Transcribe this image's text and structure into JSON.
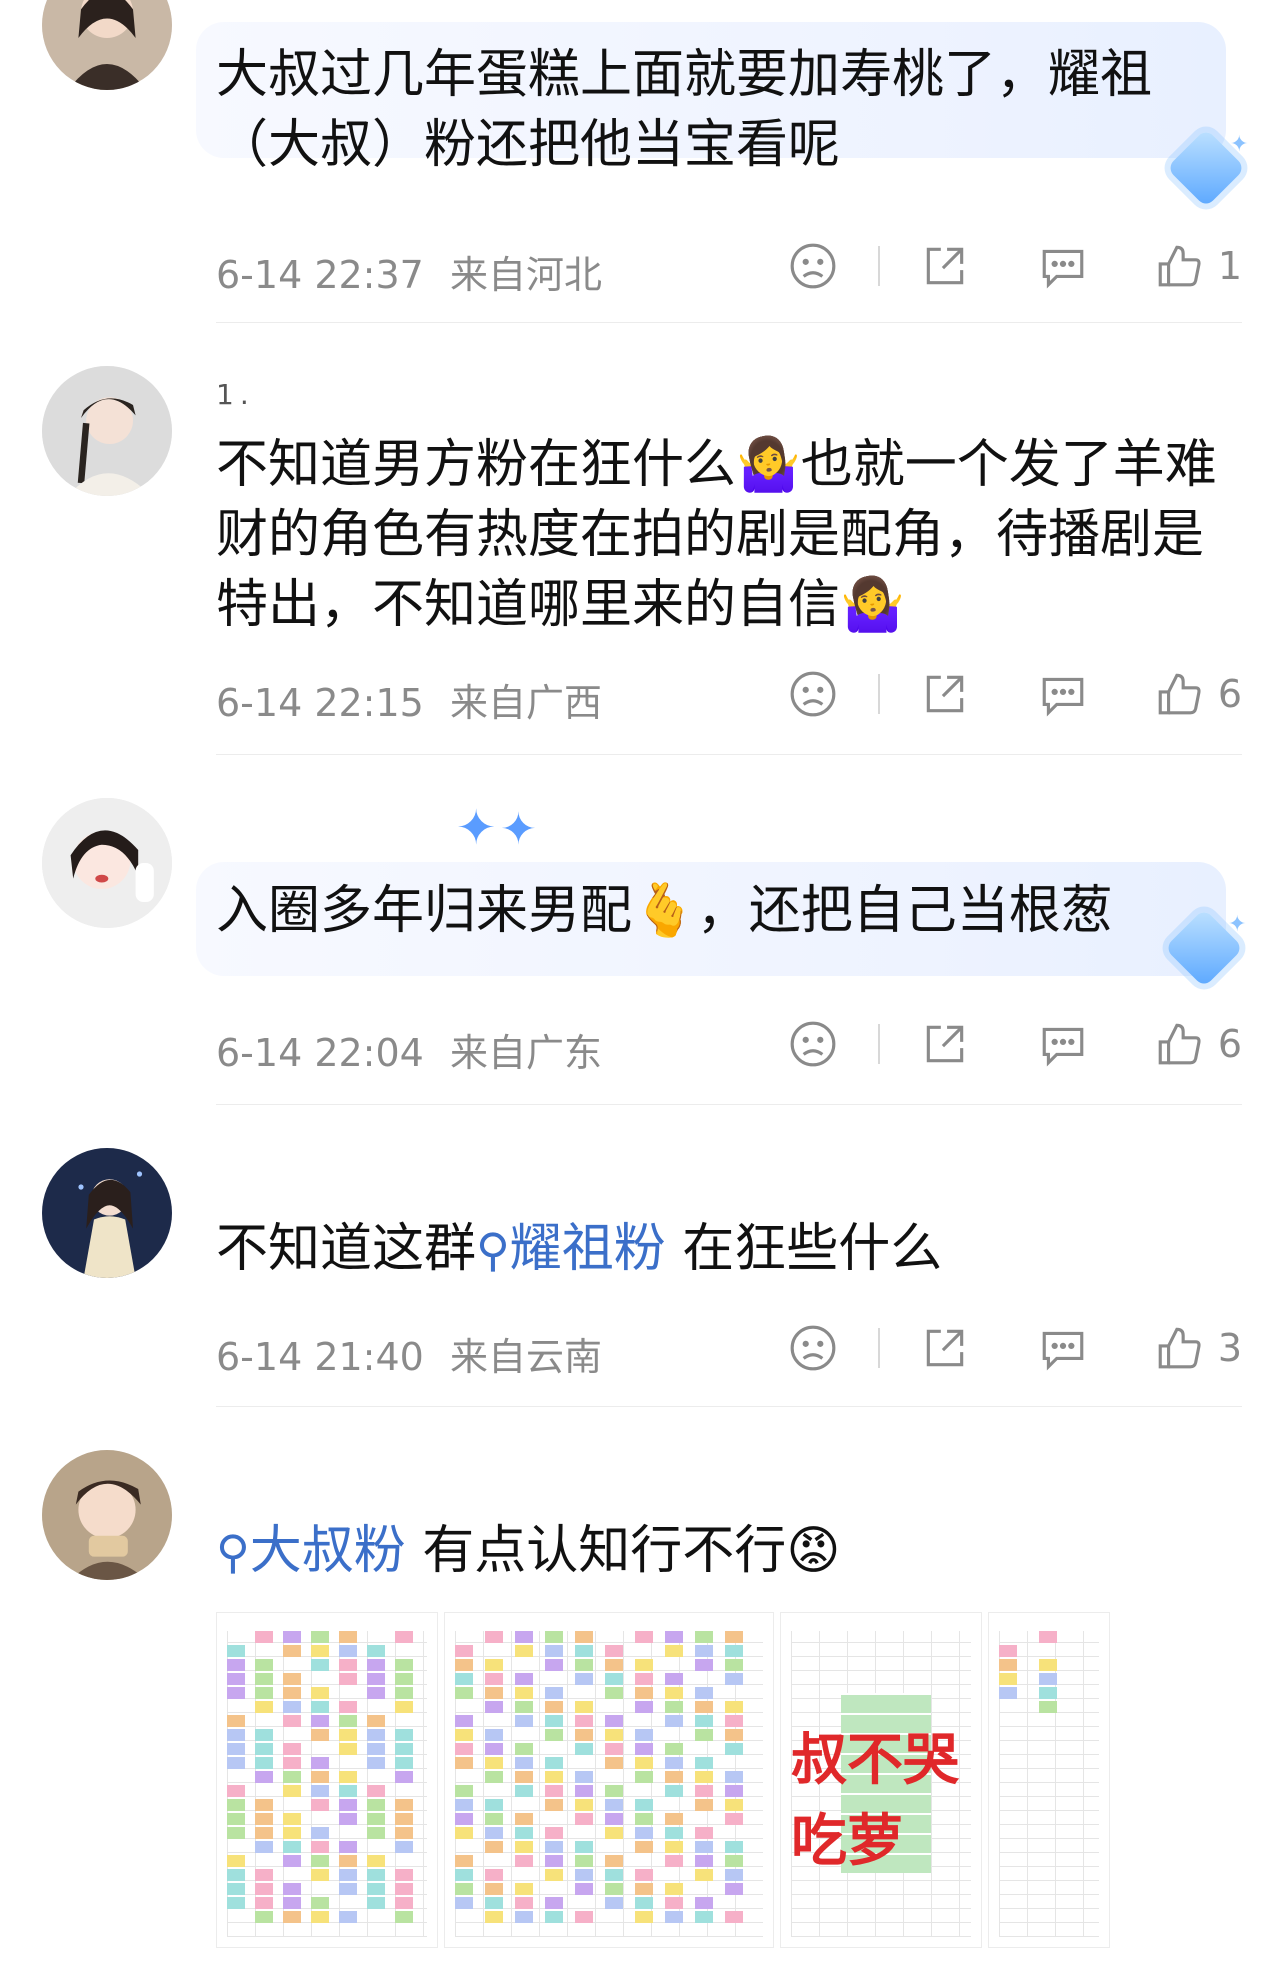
{
  "comments": [
    {
      "username": "",
      "text": "大叔过几年蛋糕上面就要加寿桃了，耀祖（大叔）粉还把他当宝看呢",
      "time": "6-14 22:37",
      "location": "来自河北",
      "likes": "1"
    },
    {
      "username": "1.",
      "text": "不知道男方粉在狂什么🤷‍♀️也就一个发了羊难财的角色有热度在拍的剧是配角，待播剧是特出，不知道哪里来的自信🤷‍♀️",
      "time": "6-14 22:15",
      "location": "来自广西",
      "likes": "6"
    },
    {
      "username": "",
      "text": "入圈多年归来男配🫰，还把自己当根葱",
      "time": "6-14 22:04",
      "location": "来自广东",
      "likes": "6"
    },
    {
      "username": "",
      "text_prefix": "不知道这群",
      "tag": "耀祖粉",
      "text_suffix": " 在狂些什么",
      "time": "6-14 21:40",
      "location": "来自云南",
      "likes": "3"
    },
    {
      "username": "",
      "tag": "大叔粉",
      "text_suffix": " 有点认知行不行😡",
      "banner": "叔不哭吃萝"
    }
  ],
  "icons": [
    "frown-icon",
    "share-icon",
    "comment-icon",
    "thumbs-up-icon",
    "search-tag-icon"
  ],
  "colors": {
    "tag_blue": "#3b6fc9",
    "meta_gray": "#8a8a8a",
    "banner_red": "#e0282a"
  }
}
